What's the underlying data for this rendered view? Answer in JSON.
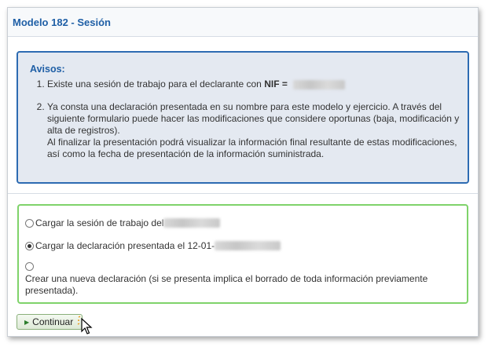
{
  "dialog": {
    "title": "Modelo 182 - Sesión"
  },
  "notice": {
    "title": "Avisos:",
    "item1_prefix": "Existe una sesión de trabajo para el declarante con ",
    "item1_nif_label": "NIF =",
    "item2_line1": "Ya consta una declaración presentada en su nombre para este modelo y ejercicio. A través del siguiente formulario puede hacer las modificaciones que considere oportunas (baja, modificación y alta de registros).",
    "item2_line2": "Al finalizar la presentación podrá visualizar la información final resultante de estas modificaciones, así como la fecha de presentación de la información suministrada."
  },
  "options": {
    "opt1_label": "Cargar la sesión de trabajo del",
    "opt2_label": "Cargar la declaración presentada el 12-01-",
    "opt3_label": "Crear una nueva declaración (si se presenta implica el borrado de toda información previamente presentada).",
    "selected": 2
  },
  "actions": {
    "continue_label": "Continuar"
  },
  "icons": {
    "continue": "triangle-right-icon",
    "cursor": "mouse-pointer-icon"
  },
  "colors": {
    "title": "#1f5fa6",
    "notice_border": "#2d6bb2",
    "notice_bg": "#e4e9f1",
    "options_border": "#7fd36a"
  }
}
